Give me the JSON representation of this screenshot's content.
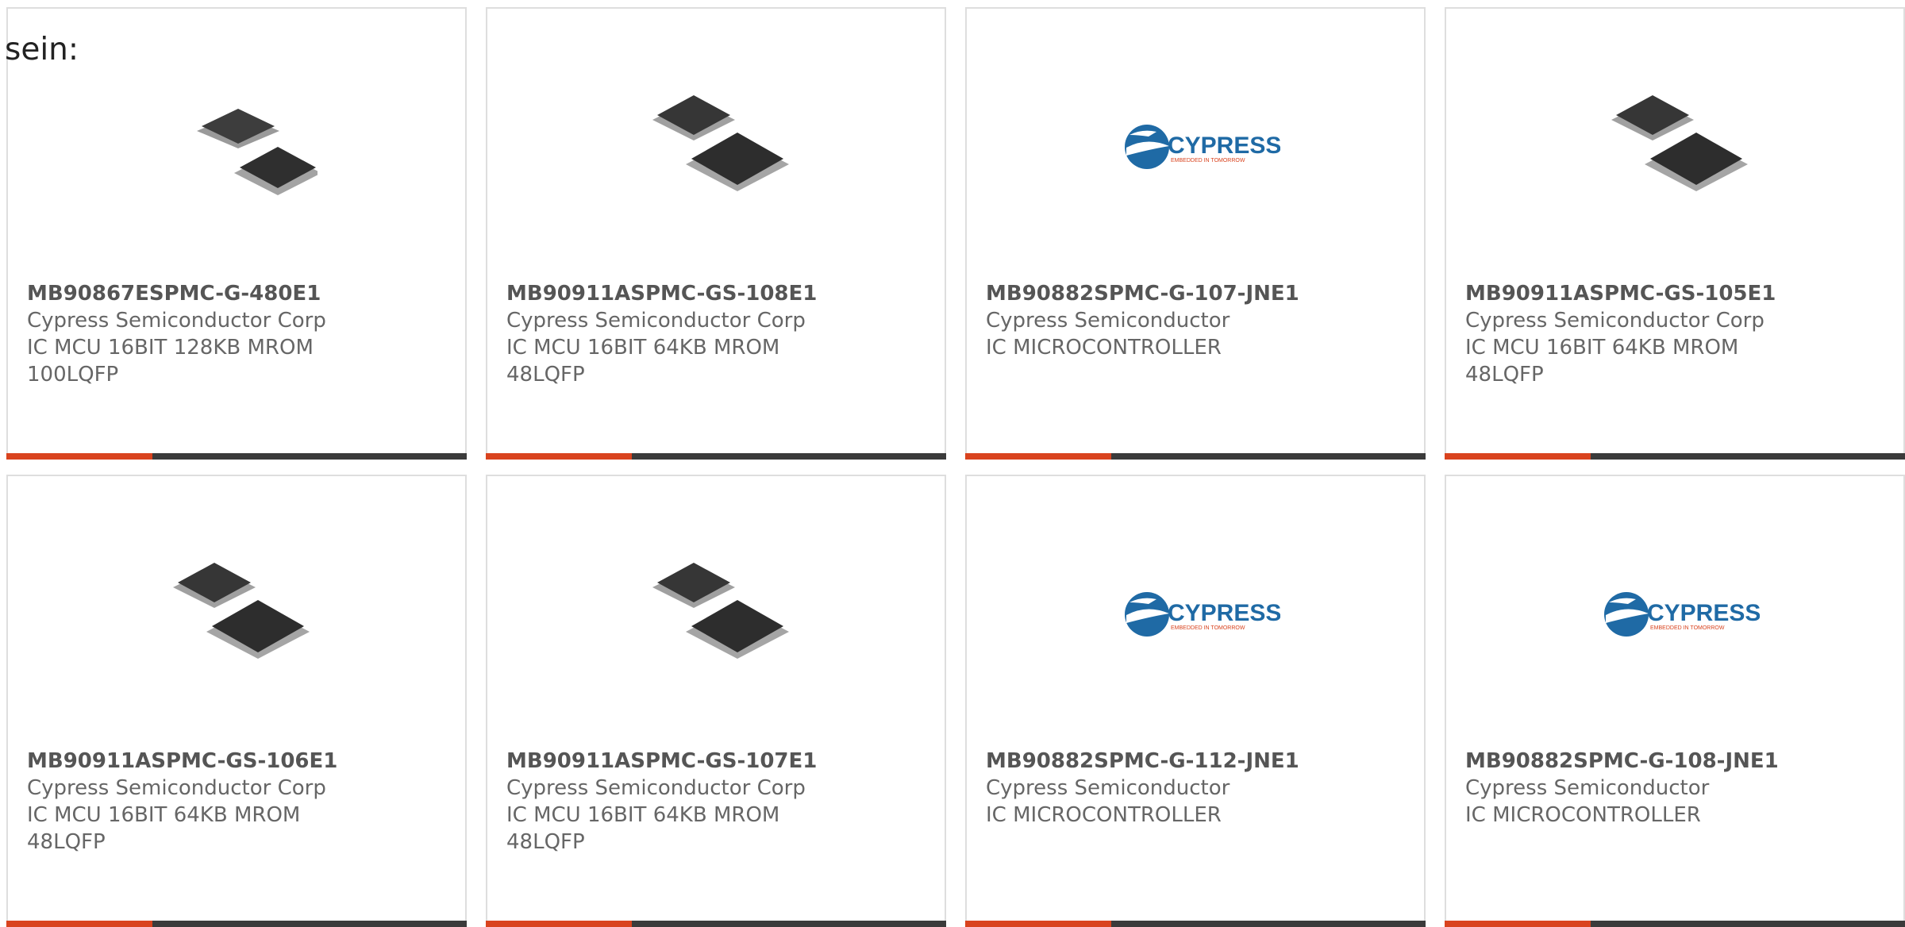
{
  "intro_text": "sein:",
  "colors": {
    "accent": "#d9431e",
    "bar_dark": "#3b3b3b",
    "border": "#dedede"
  },
  "products": [
    {
      "part_number": "MB90867ESPMC-G-480E1",
      "manufacturer": "Cypress Semiconductor Corp",
      "description": "IC MCU 16BIT 128KB MROM 100LQFP",
      "image": "qfp-chips-icon"
    },
    {
      "part_number": "MB90911ASPMC-GS-108E1",
      "manufacturer": "Cypress Semiconductor Corp",
      "description": "IC MCU 16BIT 64KB MROM 48LQFP",
      "image": "qfp-chips-icon"
    },
    {
      "part_number": "MB90882SPMC-G-107-JNE1",
      "manufacturer": "Cypress Semiconductor",
      "description": "IC MICROCONTROLLER",
      "image": "cypress-logo",
      "logo_text": "CYPRESS",
      "logo_tagline": "EMBEDDED IN TOMORROW"
    },
    {
      "part_number": "MB90911ASPMC-GS-105E1",
      "manufacturer": "Cypress Semiconductor Corp",
      "description": "IC MCU 16BIT 64KB MROM 48LQFP",
      "image": "qfp-chips-icon"
    },
    {
      "part_number": "MB90911ASPMC-GS-106E1",
      "manufacturer": "Cypress Semiconductor Corp",
      "description": "IC MCU 16BIT 64KB MROM 48LQFP",
      "image": "qfp-chips-icon"
    },
    {
      "part_number": "MB90911ASPMC-GS-107E1",
      "manufacturer": "Cypress Semiconductor Corp",
      "description": "IC MCU 16BIT 64KB MROM 48LQFP",
      "image": "qfp-chips-icon"
    },
    {
      "part_number": "MB90882SPMC-G-112-JNE1",
      "manufacturer": "Cypress Semiconductor",
      "description": "IC MICROCONTROLLER",
      "image": "cypress-logo",
      "logo_text": "CYPRESS",
      "logo_tagline": "EMBEDDED IN TOMORROW"
    },
    {
      "part_number": "MB90882SPMC-G-108-JNE1",
      "manufacturer": "Cypress Semiconductor",
      "description": "IC MICROCONTROLLER",
      "image": "cypress-logo",
      "logo_text": "CYPRESS",
      "logo_tagline": "EMBEDDED IN TOMORROW"
    }
  ]
}
